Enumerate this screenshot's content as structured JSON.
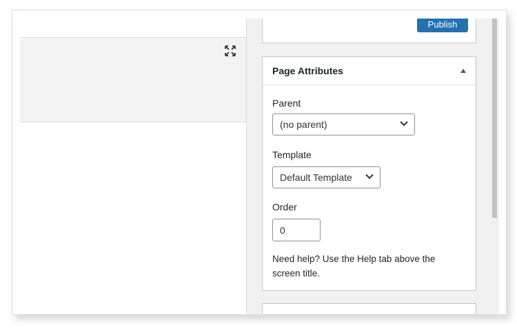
{
  "publish": {
    "button_label": "Publish"
  },
  "page_attributes": {
    "title": "Page Attributes",
    "parent": {
      "label": "Parent",
      "selected": "(no parent)"
    },
    "template": {
      "label": "Template",
      "selected": "Default Template"
    },
    "order": {
      "label": "Order",
      "value": "0"
    },
    "help": "Need help? Use the Help tab above the screen title."
  },
  "icons": {
    "fullscreen": "fullscreen-icon",
    "collapse": "triangle-up-icon",
    "dropdown": "chevron-down-icon"
  },
  "colors": {
    "primary_button": "#2271b1",
    "border": "#c3c4c7",
    "background": "#f1f1f1"
  }
}
